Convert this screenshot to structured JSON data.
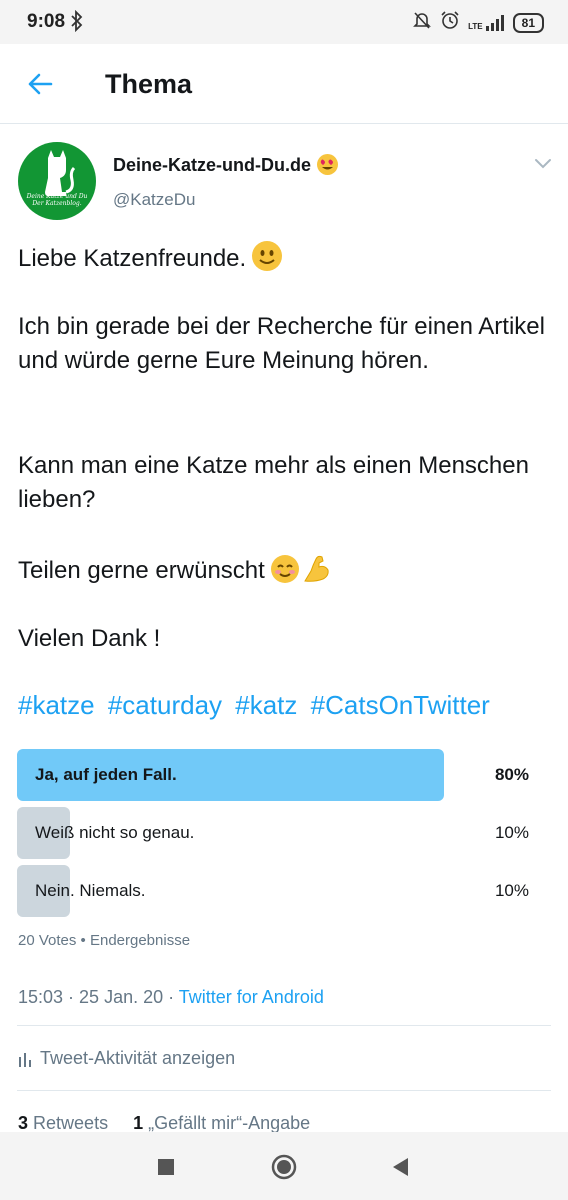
{
  "status_bar": {
    "time": "9:08",
    "lte": "LTE",
    "battery": "81"
  },
  "header": {
    "title": "Thema"
  },
  "tweet": {
    "author_name": "Deine-Katze-und-Du.de",
    "author_handle": "@KatzeDu",
    "avatar_caption_line1": "Deine Katze und Du",
    "avatar_caption_line2": "Der Katzenblog.",
    "line1": "Liebe Katzenfreunde.",
    "para2": "Ich bin gerade bei der Recherche für einen Artikel und würde gerne Eure Meinung hören.",
    "para3": "Kann man eine Katze mehr als einen Menschen lieben?",
    "para4": "Teilen gerne erwünscht",
    "para5": "Vielen Dank !",
    "hashtags": [
      "#katze",
      "#caturday",
      "#katz",
      "#CatsOnTwitter"
    ],
    "timestamp": "15:03 · 25 Jan. 20 · ",
    "source": "Twitter for Android"
  },
  "poll": {
    "options": [
      {
        "label": "Ja, auf jeden Fall.",
        "percent_text": "80%",
        "percent": 80,
        "winner": true
      },
      {
        "label": "Weiß nicht so genau.",
        "percent_text": "10%",
        "percent": 10,
        "winner": false
      },
      {
        "label": "Nein. Niemals.",
        "percent_text": "10%",
        "percent": 10,
        "winner": false
      }
    ],
    "meta": "20 Votes • Endergebnisse",
    "colors": {
      "winner": "#71c9f8",
      "other": "#ccd6dd"
    }
  },
  "activity": {
    "label": "Tweet-Aktivität anzeigen"
  },
  "stats": {
    "retweets_count": "3",
    "retweets_label": "Retweets",
    "likes_count": "1",
    "likes_label": "„Gefällt mir“-Angabe"
  },
  "icons": {
    "back": "arrow-left-icon",
    "caret": "chevron-down-icon",
    "activity": "bar-chart-icon",
    "nav_recents": "square-icon",
    "nav_home": "circle-icon",
    "nav_back": "triangle-left-icon"
  }
}
